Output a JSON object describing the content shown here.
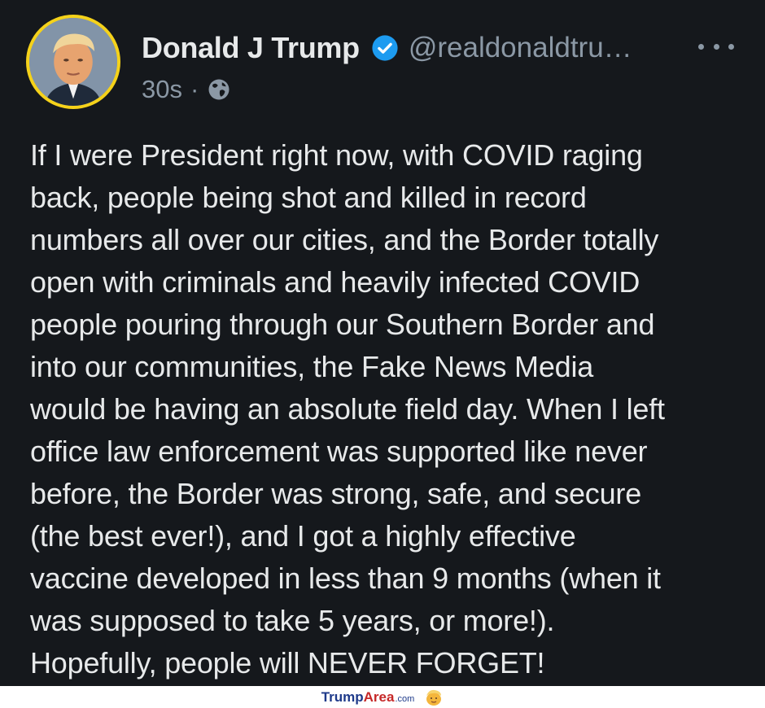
{
  "author": {
    "display_name": "Donald J Trump",
    "handle": "@realdonaldtru…",
    "verified_icon": "verified-badge-icon",
    "avatar_icon": "profile-photo"
  },
  "meta": {
    "time": "30s",
    "separator": "·",
    "visibility_icon": "globe-icon"
  },
  "post": {
    "text": "If I were President right now, with COVID raging\nback, people being shot and killed in record\nnumbers all over our cities, and the Border totally\nopen with criminals and heavily infected COVID\npeople pouring through our Southern Border and\ninto our communities, the Fake News Media\nwould be having an absolute field day. When I left\noffice law enforcement was supported like never\nbefore, the Border was strong, safe, and secure\n(the best ever!), and I got a highly effective\nvaccine developed in less than 9 months (when it\nwas supposed to take 5 years, or more!).\nHopefully, people will NEVER FORGET!"
  },
  "watermark": {
    "part1": "Trump",
    "part2": "Area",
    "part3": ".com"
  },
  "colors": {
    "background": "#15181c",
    "text": "#e7e9ea",
    "muted": "#8b98a5",
    "verified": "#1d9bf0",
    "avatar_ring": "#f5d21a"
  }
}
